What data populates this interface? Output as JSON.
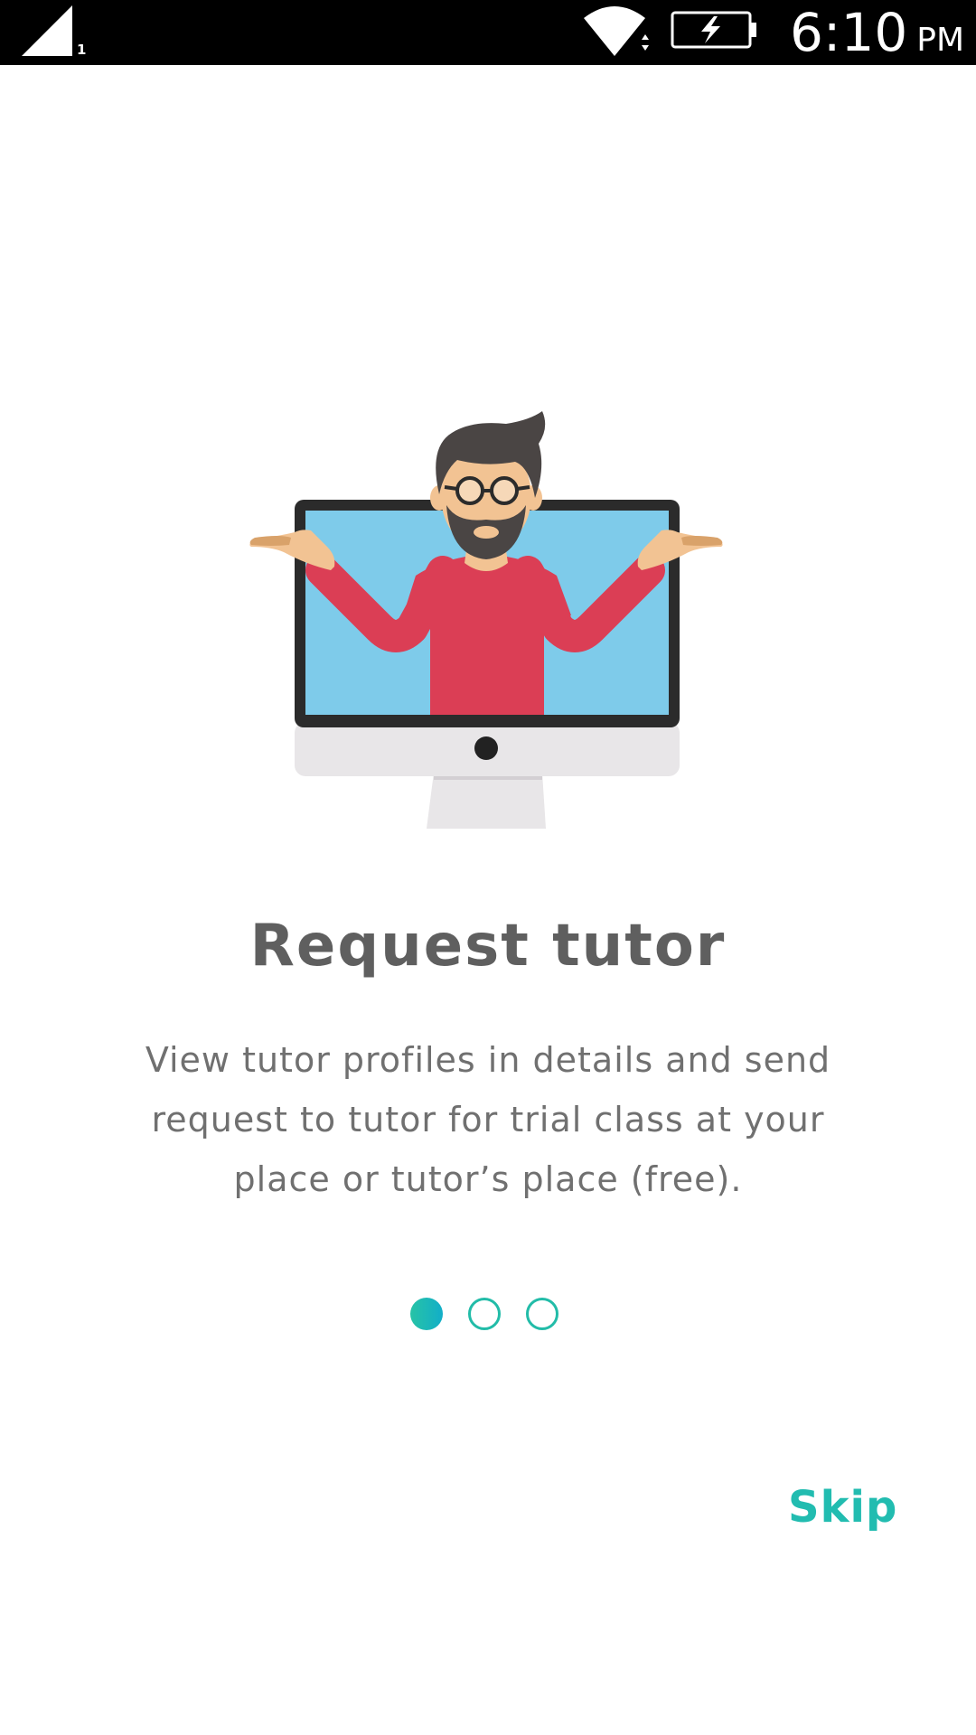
{
  "status_bar": {
    "sim_slot": "1",
    "time": "6:10",
    "ampm": "PM",
    "icons": [
      "signal-icon",
      "wifi-icon",
      "battery-charging-icon"
    ]
  },
  "onboarding": {
    "illustration": "man-in-monitor-illustration",
    "title": "Request tutor",
    "description": "View tutor profiles in details and send request to tutor for trial class at your place or tutor’s place (free).",
    "page_indicator": {
      "total": 3,
      "current": 1
    },
    "skip_label": "Skip"
  },
  "colors": {
    "accent": "#22bcb0",
    "title": "#5f5f5f",
    "body": "#707070",
    "shirt": "#db3e55",
    "screen": "#7ecbea"
  }
}
